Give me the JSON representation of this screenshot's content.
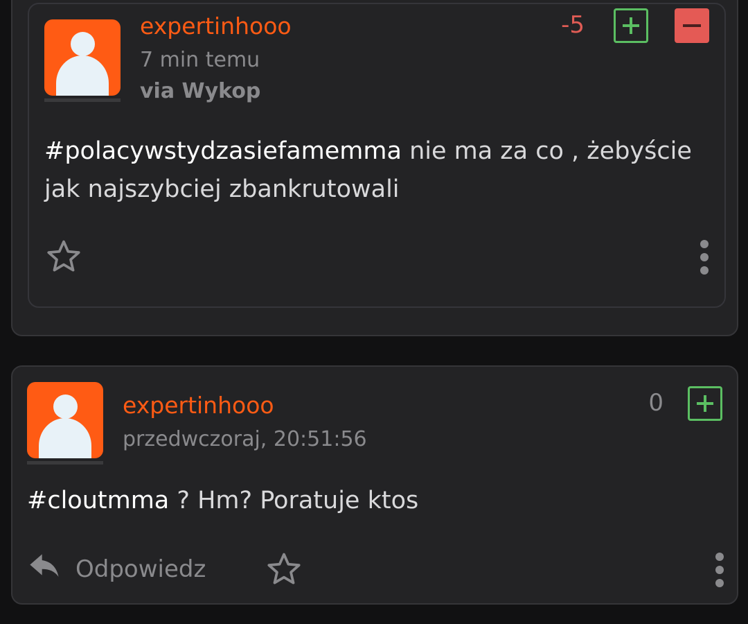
{
  "posts": [
    {
      "author": "expertinhooo",
      "time": "7 min temu",
      "via_prefix": "via ",
      "via_source": "Wykop",
      "score": "-5",
      "tag": "#polacywstydzasiefamemma",
      "text": " nie ma za co , żebyście jak najszybciej zbankrutowali"
    },
    {
      "author": "expertinhooo",
      "time": "przedwczoraj, 20:51:56",
      "score": "0",
      "tag": "#cloutmma",
      "text": " ? Hm? Poratuje ktos",
      "reply_label": "Odpowiedz"
    }
  ],
  "colors": {
    "accent": "#ff5b14",
    "plus": "#5bbe62",
    "minus": "#e45a55",
    "negative_score": "#e05c55",
    "neutral_score": "#8a8a8d"
  },
  "icons": [
    "user-avatar-icon",
    "plus-vote-icon",
    "minus-vote-icon",
    "star-icon",
    "more-vertical-icon",
    "reply-icon"
  ]
}
